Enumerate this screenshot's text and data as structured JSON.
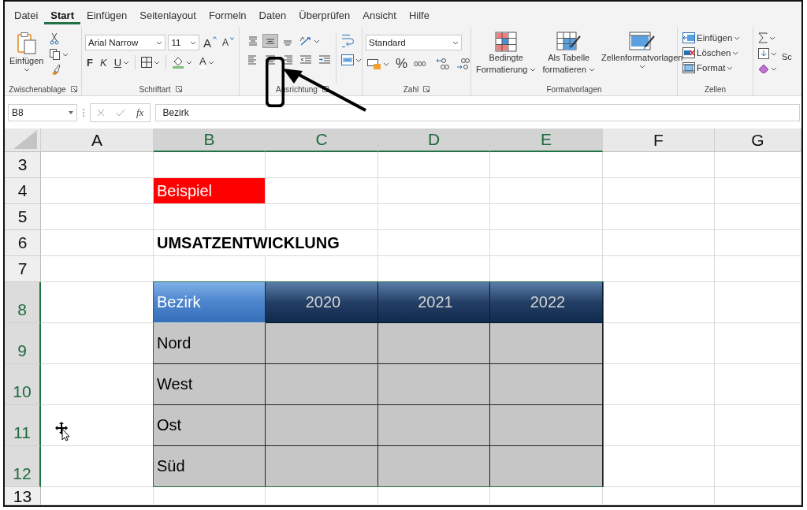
{
  "tabs": [
    {
      "label": "Datei",
      "selected": false
    },
    {
      "label": "Start",
      "selected": true
    },
    {
      "label": "Einfügen",
      "selected": false
    },
    {
      "label": "Seitenlayout",
      "selected": false
    },
    {
      "label": "Formeln",
      "selected": false
    },
    {
      "label": "Daten",
      "selected": false
    },
    {
      "label": "Überprüfen",
      "selected": false
    },
    {
      "label": "Ansicht",
      "selected": false
    },
    {
      "label": "Hilfe",
      "selected": false
    }
  ],
  "clipboard": {
    "paste": "Einfügen",
    "group_label": "Zwischenablage"
  },
  "font": {
    "name": "Arial Narrow",
    "size": "11",
    "grow": "A",
    "shrink": "A",
    "bold": "F",
    "italic": "K",
    "underline": "U",
    "font_color": "A",
    "group_label": "Schriftart"
  },
  "alignment": {
    "vertical": [
      {
        "kind": "top",
        "selected": false
      },
      {
        "kind": "middle",
        "selected": true
      },
      {
        "kind": "bottom",
        "selected": false
      }
    ],
    "horizontal": [
      {
        "kind": "left",
        "selected": false
      },
      {
        "kind": "center",
        "selected": false
      },
      {
        "kind": "right",
        "selected": false
      }
    ],
    "group_label": "Ausrichtung"
  },
  "number": {
    "format": "Standard",
    "percent": "%",
    "thousands": "000",
    "group_label": "Zahl"
  },
  "styles": {
    "buttons": [
      {
        "kind": "conditional",
        "lines": [
          "Bedingte",
          "Formatierung"
        ]
      },
      {
        "kind": "table",
        "lines": [
          "Als Tabelle",
          "formatieren"
        ]
      },
      {
        "kind": "cellstyles",
        "lines": [
          "Zellenformatvorlagen"
        ]
      }
    ],
    "group_label": "Formatvorlagen"
  },
  "cells": {
    "buttons": [
      {
        "kind": "insert",
        "label": "Einfügen"
      },
      {
        "kind": "delete",
        "label": "Löschen"
      },
      {
        "kind": "format",
        "label": "Format"
      }
    ],
    "group_label": "Zellen"
  },
  "editing": {
    "partial_label": "Sc"
  },
  "formula_bar": {
    "name_box": "B8",
    "fx": "fx",
    "value": "Bezirk"
  },
  "sheet": {
    "columns": [
      {
        "label": "A",
        "selected": false
      },
      {
        "label": "B",
        "selected": true
      },
      {
        "label": "C",
        "selected": true
      },
      {
        "label": "D",
        "selected": true
      },
      {
        "label": "E",
        "selected": true
      },
      {
        "label": "F",
        "selected": false
      },
      {
        "label": "G",
        "selected": false
      }
    ],
    "rows": [
      {
        "label": "3",
        "selected": false,
        "kind": "short",
        "cells": [
          {
            "kind": "plain"
          },
          {
            "kind": "plain"
          },
          {
            "kind": "plain"
          },
          {
            "kind": "plain"
          },
          {
            "kind": "plain"
          },
          {
            "kind": "plain"
          },
          {
            "kind": "plain"
          }
        ]
      },
      {
        "label": "4",
        "selected": false,
        "kind": "short",
        "cells": [
          {
            "kind": "plain"
          },
          {
            "kind": "label",
            "text": "Beispiel"
          },
          {
            "kind": "plain"
          },
          {
            "kind": "plain"
          },
          {
            "kind": "plain"
          },
          {
            "kind": "plain"
          },
          {
            "kind": "plain"
          }
        ]
      },
      {
        "label": "5",
        "selected": false,
        "kind": "short",
        "cells": [
          {
            "kind": "plain"
          },
          {
            "kind": "plain"
          },
          {
            "kind": "plain"
          },
          {
            "kind": "plain"
          },
          {
            "kind": "plain"
          },
          {
            "kind": "plain"
          },
          {
            "kind": "plain"
          }
        ]
      },
      {
        "label": "6",
        "selected": false,
        "kind": "short",
        "cells": [
          {
            "kind": "plain"
          },
          {
            "kind": "title",
            "text": "UMSATZENTWICKLUNG"
          },
          {
            "kind": "plain"
          },
          {
            "kind": "plain"
          },
          {
            "kind": "plain"
          },
          {
            "kind": "plain"
          }
        ]
      },
      {
        "label": "7",
        "selected": false,
        "kind": "short",
        "cells": [
          {
            "kind": "plain"
          },
          {
            "kind": "plain"
          },
          {
            "kind": "plain"
          },
          {
            "kind": "plain"
          },
          {
            "kind": "plain"
          },
          {
            "kind": "plain"
          },
          {
            "kind": "plain"
          }
        ]
      },
      {
        "label": "8",
        "selected": true,
        "kind": "tall",
        "cells": [
          {
            "kind": "plain"
          },
          {
            "kind": "header",
            "text": "Bezirk"
          },
          {
            "kind": "header-year",
            "text": "2020"
          },
          {
            "kind": "header-year",
            "text": "2021"
          },
          {
            "kind": "header-year",
            "text": "2022"
          },
          {
            "kind": "plain"
          },
          {
            "kind": "plain"
          }
        ]
      },
      {
        "label": "9",
        "selected": true,
        "kind": "tall",
        "cells": [
          {
            "kind": "plain"
          },
          {
            "kind": "body",
            "text": "Nord"
          },
          {
            "kind": "body"
          },
          {
            "kind": "body"
          },
          {
            "kind": "body"
          },
          {
            "kind": "plain"
          },
          {
            "kind": "plain"
          }
        ]
      },
      {
        "label": "10",
        "selected": true,
        "kind": "tall",
        "cells": [
          {
            "kind": "plain"
          },
          {
            "kind": "body",
            "text": "West"
          },
          {
            "kind": "body"
          },
          {
            "kind": "body"
          },
          {
            "kind": "body"
          },
          {
            "kind": "plain"
          },
          {
            "kind": "plain"
          }
        ]
      },
      {
        "label": "11",
        "selected": true,
        "kind": "tall",
        "cells": [
          {
            "kind": "plain"
          },
          {
            "kind": "body",
            "text": "Ost"
          },
          {
            "kind": "body"
          },
          {
            "kind": "body"
          },
          {
            "kind": "body"
          },
          {
            "kind": "plain"
          },
          {
            "kind": "plain"
          }
        ]
      },
      {
        "label": "12",
        "selected": true,
        "kind": "tall",
        "cells": [
          {
            "kind": "plain"
          },
          {
            "kind": "body",
            "text": "Süd"
          },
          {
            "kind": "body"
          },
          {
            "kind": "body"
          },
          {
            "kind": "body"
          },
          {
            "kind": "plain"
          },
          {
            "kind": "plain"
          }
        ]
      },
      {
        "label": "13",
        "selected": false,
        "kind": "cut",
        "cells": [
          {
            "kind": "plain"
          },
          {
            "kind": "plain"
          },
          {
            "kind": "plain"
          },
          {
            "kind": "plain"
          },
          {
            "kind": "plain"
          },
          {
            "kind": "plain"
          },
          {
            "kind": "plain"
          }
        ]
      }
    ]
  }
}
